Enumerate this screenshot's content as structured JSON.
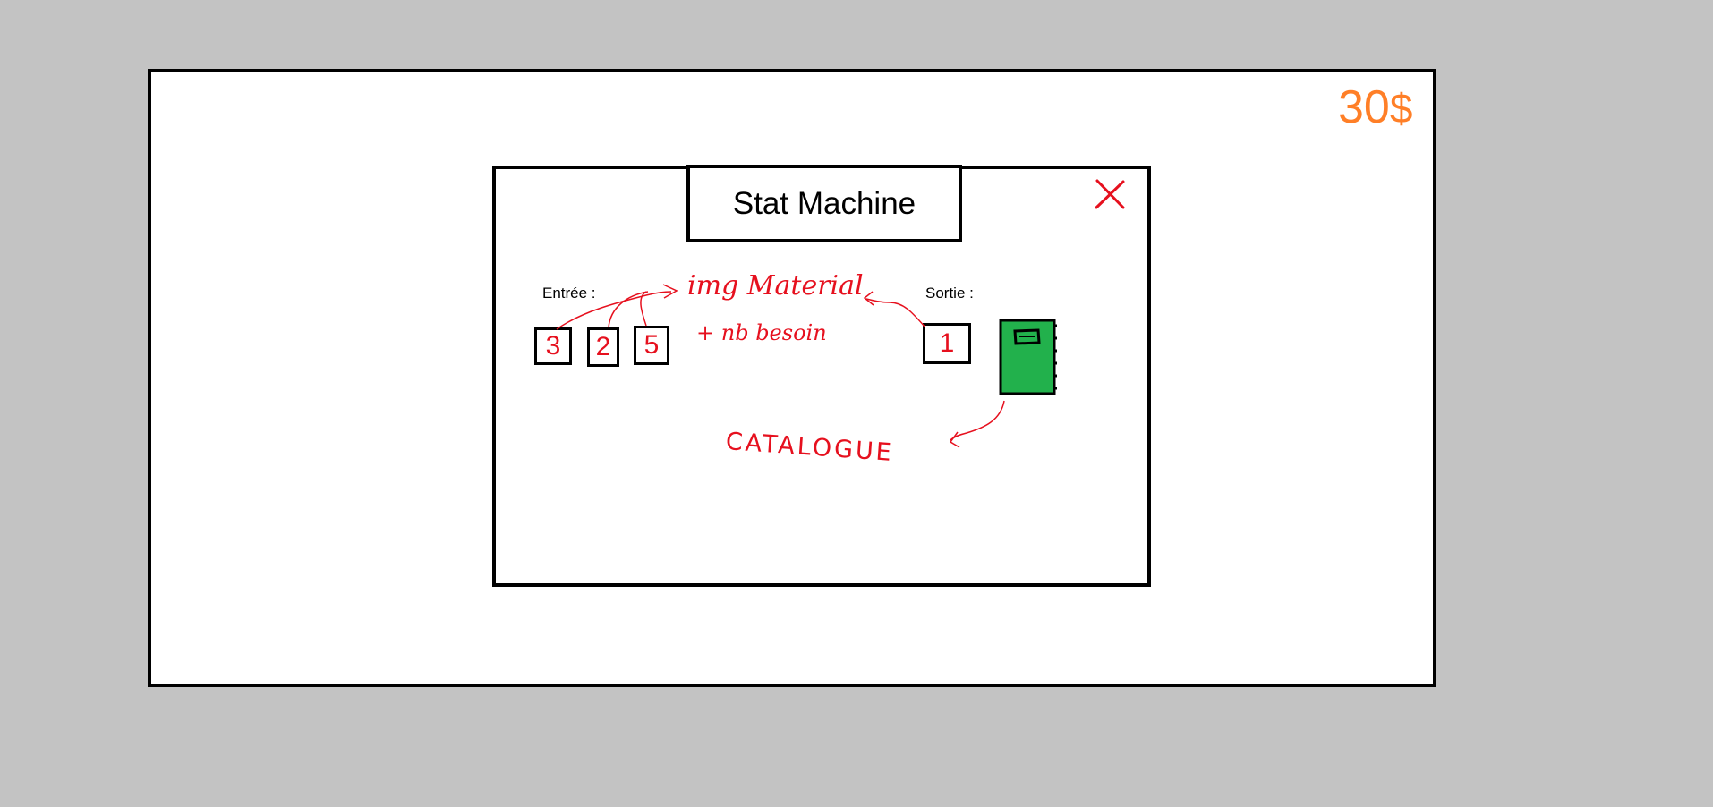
{
  "hud": {
    "money_amount": "30",
    "money_symbol": "$"
  },
  "dialog": {
    "title": "Stat Machine",
    "close_icon": "close-icon",
    "input_label": "Entrée :",
    "output_label": "Sortie :",
    "input_slots": [
      "3",
      "2",
      "5"
    ],
    "output_slots": [
      "1"
    ],
    "catalogue_icon": "book-icon"
  },
  "annotations": {
    "material_note_line1": "img Material",
    "material_note_line2": "+ nb besoin",
    "catalogue_note": "CATALOGUE"
  },
  "colors": {
    "background": "#c3c3c3",
    "annotation_red": "#e6101e",
    "money_orange": "#ff7f27",
    "catalogue_green": "#22b14c"
  }
}
